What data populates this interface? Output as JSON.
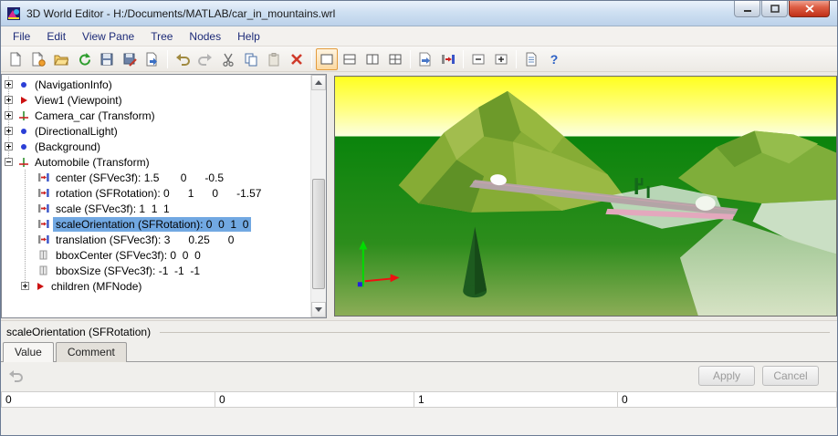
{
  "window": {
    "title": "3D World Editor - H:/Documents/MATLAB/car_in_mountains.wrl"
  },
  "menus": [
    "File",
    "Edit",
    "View Pane",
    "Tree",
    "Nodes",
    "Help"
  ],
  "toolbar": {
    "icons": [
      "new-icon",
      "new-from-template-icon",
      "open-icon",
      "refresh-icon",
      "save-icon",
      "save-edit-icon",
      "export-icon",
      "undo-icon",
      "redo-icon",
      "cut-icon",
      "copy-icon",
      "paste-icon",
      "delete-icon",
      "layout-single-icon",
      "layout-split-h-icon",
      "layout-split-v-icon",
      "layout-quad-icon",
      "node-insert-icon",
      "node-connector-icon",
      "collapse-all-icon",
      "expand-all-icon",
      "documentation-icon",
      "help-icon"
    ],
    "selected_layout": "layout-single",
    "help_glyph": "?"
  },
  "tree": {
    "items": [
      {
        "text": "(NavigationInfo)"
      },
      {
        "text": "View1 (Viewpoint)"
      },
      {
        "text": "Camera_car (Transform)"
      },
      {
        "text": "(DirectionalLight)"
      },
      {
        "text": "(Background)"
      },
      {
        "text": "Automobile (Transform)"
      },
      {
        "text": "center (SFVec3f): 1.5       0      -0.5"
      },
      {
        "text": "rotation (SFRotation): 0      1      0      -1.57"
      },
      {
        "text": "scale (SFVec3f): 1  1  1"
      },
      {
        "text": "scaleOrientation (SFRotation): 0  0  1  0"
      },
      {
        "text": "translation (SFVec3f): 3      0.25      0"
      },
      {
        "text": "bboxCenter (SFVec3f): 0  0  0"
      },
      {
        "text": "bboxSize (SFVec3f): -1  -1  -1"
      },
      {
        "text": "children (MFNode)"
      }
    ],
    "selected_index": 9
  },
  "viewport": {
    "colors": {
      "sky_top": "#ffff1f",
      "sky_horizon": "#fbffe8",
      "ground": "#0a840c",
      "mountain": "#86ac35",
      "road": "#b3a4a6",
      "road_edge_pink": "#e3a8bd",
      "tree": "#1d5b1f",
      "axis_x": "#ee1111",
      "axis_y": "#00dd00",
      "origin_dot": "#2222dd"
    }
  },
  "bottom": {
    "panel_title": "scaleOrientation (SFRotation)",
    "tabs": [
      "Value",
      "Comment"
    ],
    "active_tab": "Value",
    "apply_label": "Apply",
    "cancel_label": "Cancel",
    "values": [
      "0",
      "0",
      "1",
      "0"
    ]
  }
}
